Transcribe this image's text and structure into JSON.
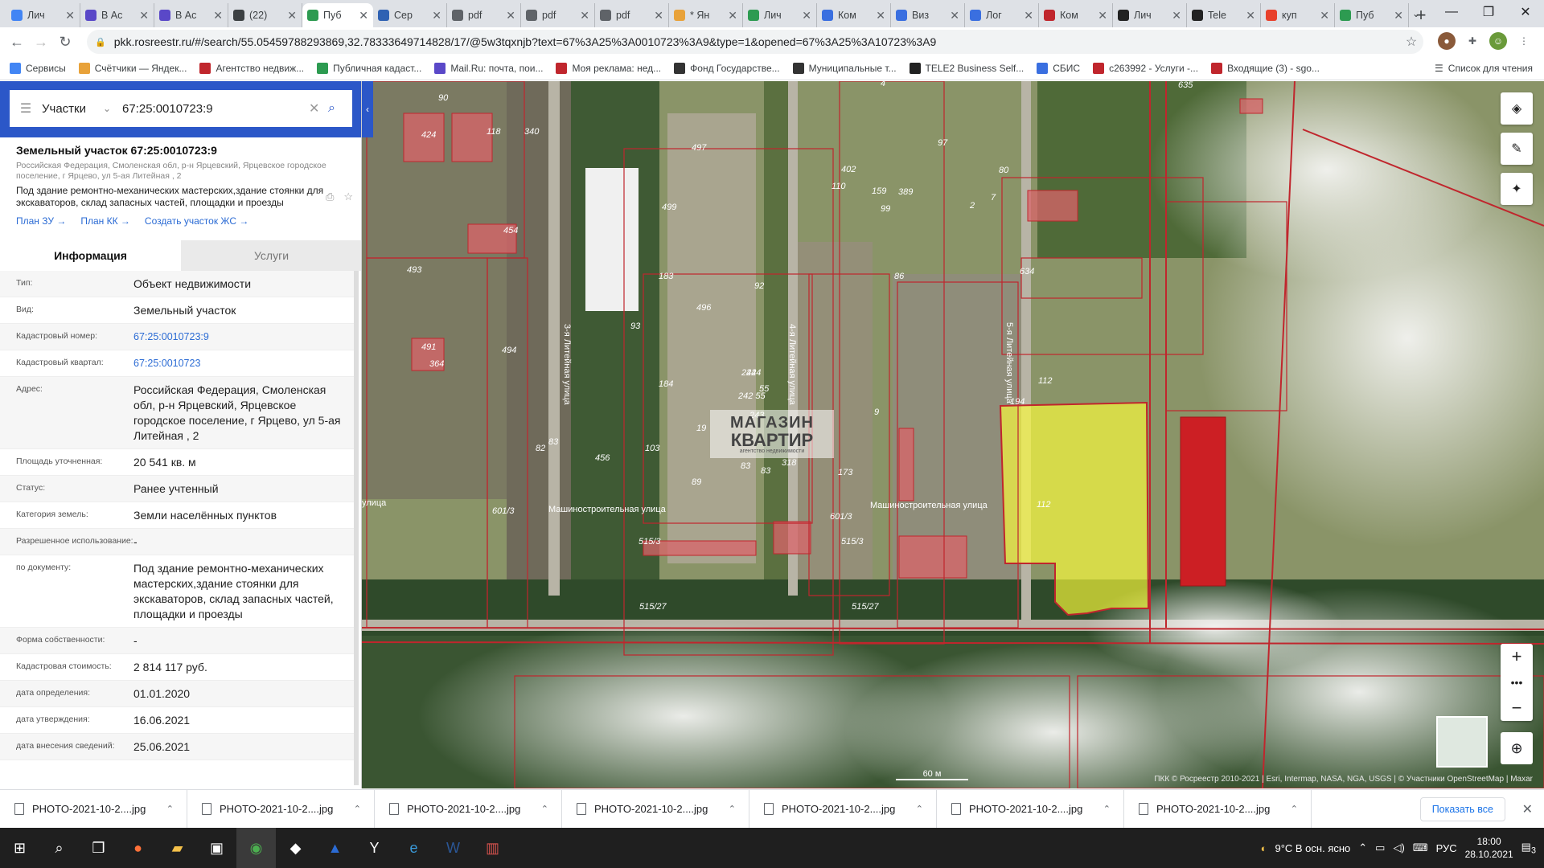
{
  "tabs": [
    {
      "label": "Лич",
      "color": "#4285f4"
    },
    {
      "label": "В Ас",
      "color": "#5a48c8"
    },
    {
      "label": "В Ас",
      "color": "#5a48c8"
    },
    {
      "label": "(22)",
      "color": "#3c4043"
    },
    {
      "label": "Пуб",
      "color": "#2d9b51",
      "active": true
    },
    {
      "label": "Сер",
      "color": "#2f62b3"
    },
    {
      "label": "pdf",
      "color": "#5f6368"
    },
    {
      "label": "pdf",
      "color": "#5f6368"
    },
    {
      "label": "pdf",
      "color": "#5f6368"
    },
    {
      "label": "* Ян",
      "color": "#e8a23a"
    },
    {
      "label": "Лич",
      "color": "#2d9b51"
    },
    {
      "label": "Ком",
      "color": "#3a6fe0"
    },
    {
      "label": "Виз",
      "color": "#3a6fe0"
    },
    {
      "label": "Лог",
      "color": "#3a6fe0"
    },
    {
      "label": "Ком",
      "color": "#c0262d"
    },
    {
      "label": "Лич",
      "color": "#222"
    },
    {
      "label": "Tele",
      "color": "#222"
    },
    {
      "label": "куп",
      "color": "#e8412c"
    },
    {
      "label": "Пуб",
      "color": "#2d9b51"
    }
  ],
  "address_bar": {
    "url": "pkk.rosreestr.ru/#/search/55.05459788293869,32.78333649714828/17/@5w3tqxnjb?text=67%3A25%3A0010723%3A9&type=1&opened=67%3A25%3A10723%3A9"
  },
  "bookmarks": [
    {
      "label": "Сервисы",
      "color": "#4285f4"
    },
    {
      "label": "Счётчики — Яндек...",
      "color": "#e8a23a"
    },
    {
      "label": "Агентство недвиж...",
      "color": "#c0262d"
    },
    {
      "label": "Публичная кадаст...",
      "color": "#2d9b51"
    },
    {
      "label": "Mail.Ru: почта, пои...",
      "color": "#5a48c8"
    },
    {
      "label": "Моя реклама: нед...",
      "color": "#c0262d"
    },
    {
      "label": "Фонд Государстве...",
      "color": "#333"
    },
    {
      "label": "Муниципальные т...",
      "color": "#333"
    },
    {
      "label": "TELE2 Business Self...",
      "color": "#222"
    },
    {
      "label": "СБИС",
      "color": "#3a6fe0"
    },
    {
      "label": "c263992 - Услуги -...",
      "color": "#c0262d"
    },
    {
      "label": "Входящие (3) - sgo...",
      "color": "#c0262d"
    }
  ],
  "reading_list": "Список для чтения",
  "search": {
    "type_label": "Участки",
    "value": "67:25:0010723:9"
  },
  "object": {
    "title": "Земельный участок 67:25:0010723:9",
    "address": "Российская Федерация, Смоленская обл, р-н Ярцевский, Ярцевское городское поселение, г Ярцево, ул 5-ая Литейная , 2",
    "description": "Под здание ремонтно-механических мастерских,здание стоянки для экскаваторов, склад запасных частей, площадки и проезды",
    "links": [
      "План ЗУ →",
      "План КК →",
      "Создать участок ЖС →"
    ]
  },
  "panel_tabs": {
    "info": "Информация",
    "services": "Услуги"
  },
  "info_rows": [
    {
      "key": "Тип:",
      "value": "Объект недвижимости"
    },
    {
      "key": "Вид:",
      "value": "Земельный участок"
    },
    {
      "key": "Кадастровый номер:",
      "value": "67:25:0010723:9",
      "link": true
    },
    {
      "key": "Кадастровый квартал:",
      "value": "67:25:0010723",
      "link": true
    },
    {
      "key": "Адрес:",
      "value": "Российская Федерация, Смоленская обл, р-н Ярцевский, Ярцевское городское поселение, г Ярцево, ул 5-ая Литейная , 2"
    },
    {
      "key": "Площадь уточненная:",
      "value": "20 541 кв. м"
    },
    {
      "key": "Статус:",
      "value": "Ранее учтенный"
    },
    {
      "key": "Категория земель:",
      "value": "Земли населённых пунктов"
    },
    {
      "key": "Разрешенное использование:",
      "value": "-"
    },
    {
      "key": "по документу:",
      "value": "Под здание ремонтно-механических мастерских,здание стоянки для экскаваторов, склад запасных частей, площадки и проезды"
    },
    {
      "key": "Форма собственности:",
      "value": "-"
    },
    {
      "key": "Кадастровая стоимость:",
      "value": "2 814 117 руб."
    },
    {
      "key": "дата определения:",
      "value": "01.01.2020"
    },
    {
      "key": "дата утверждения:",
      "value": "16.06.2021"
    },
    {
      "key": "дата внесения сведений:",
      "value": "25.06.2021"
    }
  ],
  "map": {
    "labels": [
      "90",
      "118",
      "340",
      "424",
      "454",
      "493",
      "491",
      "364",
      "494",
      "497",
      "499",
      "183",
      "93",
      "184",
      "496",
      "82",
      "83",
      "456",
      "103",
      "19",
      "89",
      "92",
      "244",
      "55",
      "243",
      "242",
      "242 55",
      "318",
      "83",
      "83",
      "173",
      "402",
      "110",
      "159",
      "389",
      "99",
      "97",
      "4",
      "635",
      "80",
      "2",
      "7",
      "634",
      "86",
      "112",
      "194",
      "112",
      "601/3",
      "601/3",
      "515/3",
      "515/3",
      "515/27",
      "515/27",
      "9"
    ],
    "streets": [
      "Машиностроительная улица",
      "Машиностроительная улица",
      "3-я Литейная улица",
      "4-я Литейная улица",
      "5-я Литейная улица",
      "улица"
    ],
    "scale": "60 м",
    "attribution": "ПКК © Росреестр 2010-2021 | Esri, Intermap, NASA, NGA, USGS | © Участники OpenStreetMap | Maxar",
    "watermark": {
      "line1": "МАГАЗИН",
      "line2": "КВАРТИР",
      "line3": "агентство недвижимости"
    }
  },
  "downloads": {
    "items": [
      "PHOTO-2021-10-2....jpg",
      "PHOTO-2021-10-2....jpg",
      "PHOTO-2021-10-2....jpg",
      "PHOTO-2021-10-2....jpg",
      "PHOTO-2021-10-2....jpg",
      "PHOTO-2021-10-2....jpg",
      "PHOTO-2021-10-2....jpg"
    ],
    "show_all": "Показать все"
  },
  "taskbar": {
    "weather": "9°C  В осн. ясно",
    "lang": "РУС",
    "time": "18:00",
    "date": "28.10.2021",
    "notifications": "3"
  }
}
